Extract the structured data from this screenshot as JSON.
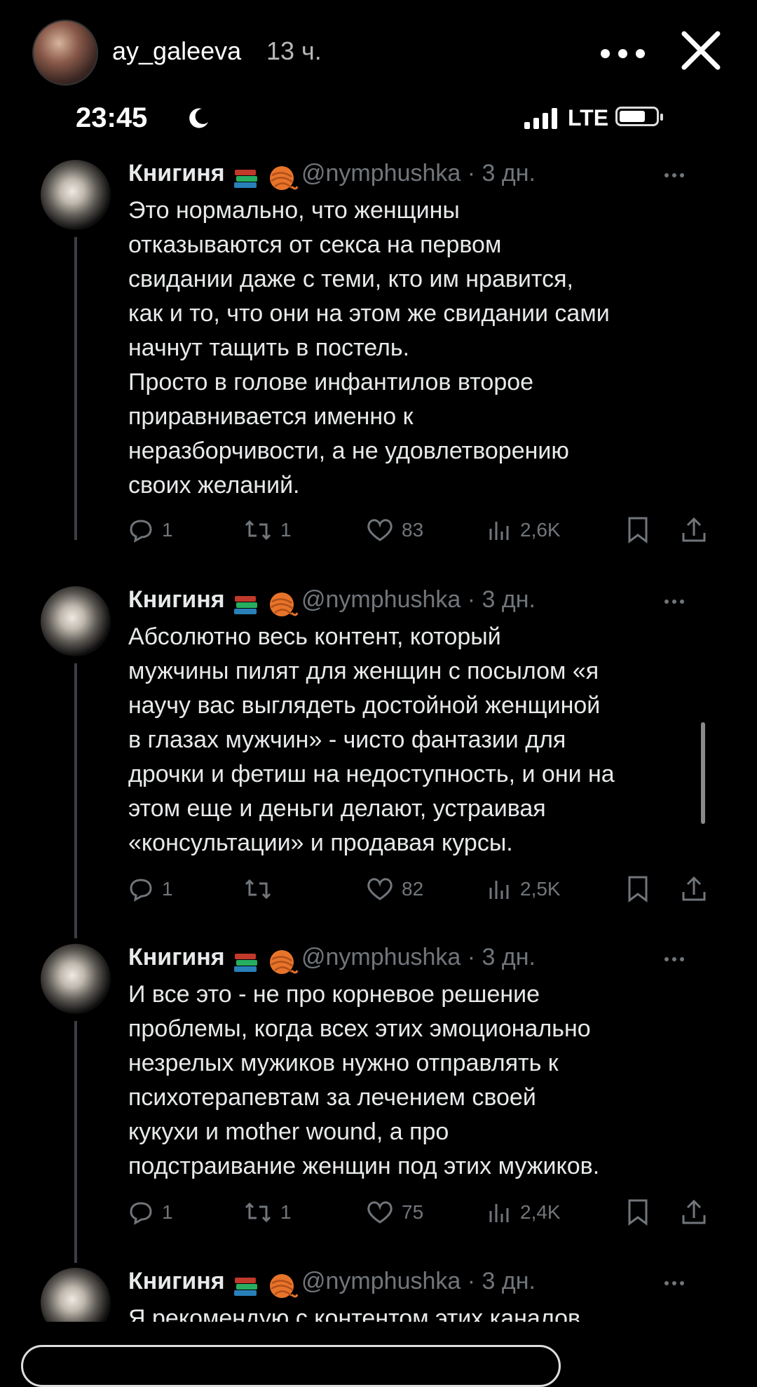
{
  "story": {
    "username": "ay_galeeva",
    "time_ago": "13 ч."
  },
  "status_bar": {
    "time": "23:45",
    "network": "LTE"
  },
  "tweets": [
    {
      "name": "Книгиня",
      "handle": "@nymphushka · 3 дн.",
      "text": "Это нормально, что женщины\nотказываются от секса на первом\nсвидании даже с теми, кто им нравится,\nкак и то, что они на этом же свидании сами\nначнут тащить в постель.\nПросто в голове инфантилов второе\nприравнивается именно к\nнеразборчивости, а не удовлетворению\nсвоих желаний.",
      "replies": "1",
      "reposts": "1",
      "likes": "83",
      "views": "2,6K"
    },
    {
      "name": "Книгиня",
      "handle": "@nymphushka · 3 дн.",
      "text": "Абсолютно весь контент, который\nмужчины пилят для женщин с посылом «я\nнаучу вас выглядеть достойной женщиной\nв глазах мужчин» - чисто фантазии для\nдрочки и фетиш на недоступность, и они на\nэтом еще и деньги делают, устраивая\n«консультации» и продавая курсы.",
      "replies": "1",
      "reposts": "",
      "likes": "82",
      "views": "2,5K"
    },
    {
      "name": "Книгиня",
      "handle": "@nymphushka · 3 дн.",
      "text": "И все это - не про корневое решение\nпроблемы, когда всех этих эмоционально\nнезрелых мужиков нужно отправлять к\nпсихотерапевтам за лечением своей\nкукухи и mother wound, а про\nподстраивание женщин под этих мужиков.",
      "replies": "1",
      "reposts": "1",
      "likes": "75",
      "views": "2,4K"
    },
    {
      "name": "Книгиня",
      "handle": "@nymphushka · 3 дн.",
      "text": "Я рекомендую с контентом этих каналов",
      "replies": "",
      "reposts": "",
      "likes": "",
      "views": ""
    }
  ],
  "icons": {
    "story_more": "more-horizontal-icon",
    "story_close": "close-icon",
    "reply": "reply-icon",
    "repost": "repost-icon",
    "like": "heart-icon",
    "views": "views-icon",
    "bookmark": "bookmark-icon",
    "share": "share-icon"
  }
}
